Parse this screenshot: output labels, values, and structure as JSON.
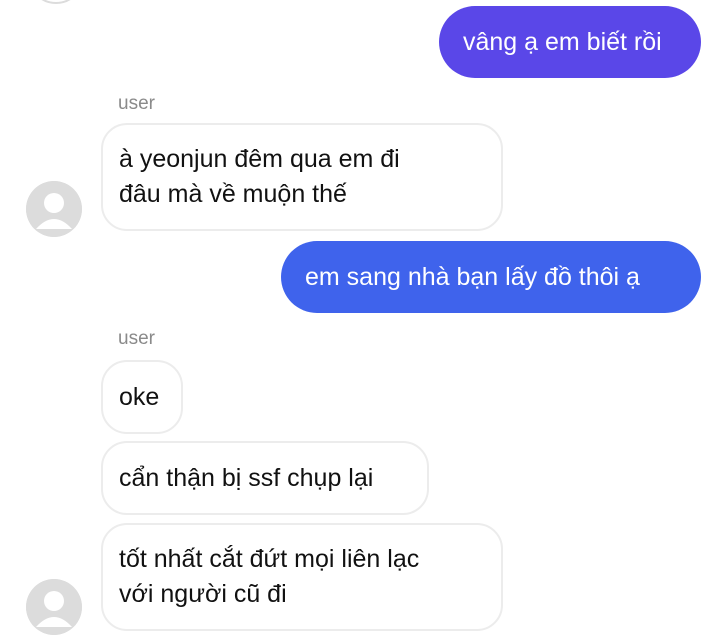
{
  "colors": {
    "outgoing_top": "#5a47e8",
    "outgoing_bottom": "#3f63ec",
    "incoming_border": "#ececec",
    "avatar_gray": "#dcdcdc",
    "sender_gray": "#8a8a8a"
  },
  "messages": [
    {
      "side": "out",
      "text": "vâng ạ em biết rồi"
    },
    {
      "side": "in",
      "sender": "user",
      "text": "à yeonjun đêm qua em đi\nđâu mà về muộn thế"
    },
    {
      "side": "out",
      "text": "em sang nhà bạn lấy đồ thôi ạ"
    },
    {
      "side": "in",
      "sender": "user",
      "text": "oke"
    },
    {
      "side": "in",
      "text": "cẩn thận bị ssf chụp lại"
    },
    {
      "side": "in",
      "text": "tốt nhất cắt đứt mọi liên lạc\nvới người cũ đi"
    }
  ],
  "icons": {
    "avatar": "default-user-avatar-icon"
  }
}
